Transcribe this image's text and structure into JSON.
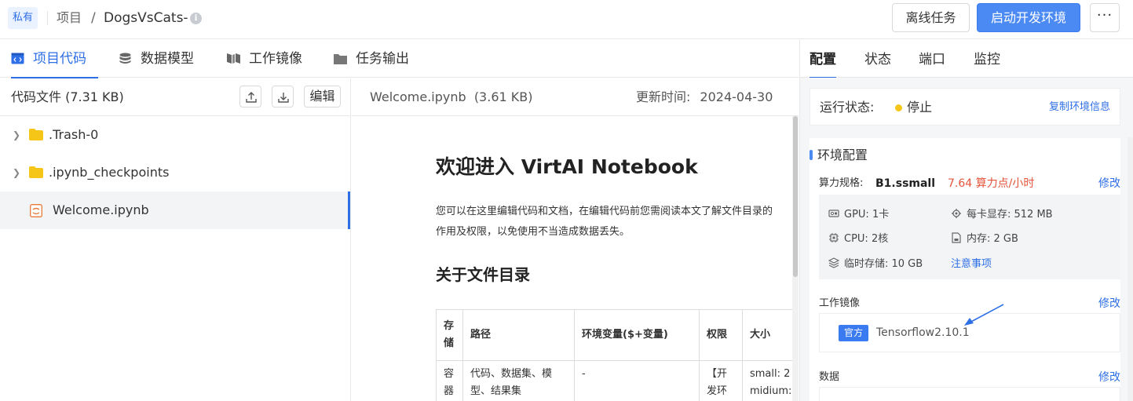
{
  "header": {
    "private_badge": "私有",
    "breadcrumb_project": "项目",
    "breadcrumb_sep": "/",
    "project_name": "DogsVsCats-",
    "offline_task_label": "离线任务",
    "start_env_label": "启动开发环境",
    "more_label": "···"
  },
  "tabs": {
    "code": "项目代码",
    "data_model": "数据模型",
    "work_image": "工作镜像",
    "task_output": "任务输出"
  },
  "file_panel": {
    "title": "代码文件 (7.31 KB)",
    "edit_label": "编辑",
    "items": [
      {
        "name": ".Trash-0",
        "type": "folder"
      },
      {
        "name": ".ipynb_checkpoints",
        "type": "folder"
      },
      {
        "name": "Welcome.ipynb",
        "type": "notebook"
      }
    ]
  },
  "document": {
    "file_name": "Welcome.ipynb  (3.61 KB)",
    "updated_label": "更新时间:",
    "updated_value": "2024-04-30",
    "h1": "欢迎进入 VirtAI Notebook",
    "intro": "您可以在这里编辑代码和文档，在编辑代码前您需阅读本文了解文件目录的作用及权限，以免使用不当造成数据丢失。",
    "h2": "关于文件目录",
    "table": {
      "headers": [
        "存储",
        "路径",
        "环境变量($+变量)",
        "权限",
        "大小"
      ],
      "row1": [
        "容器",
        "代码、数据集、模型、结果集",
        "-",
        "【开发环",
        "small: 2 midium: "
      ]
    }
  },
  "right_panel": {
    "tabs": [
      "配置",
      "状态",
      "端口",
      "监控"
    ],
    "status_label": "运行状态:",
    "status_value": "停止",
    "copy_env_label": "复制环境信息",
    "env_title": "环境配置",
    "spec_label": "算力规格:",
    "spec_value": "B1.ssmall",
    "spec_price": "7.64 算力点/小时",
    "edit_label": "修改",
    "resources": {
      "gpu": "GPU: 1卡",
      "vram": "每卡显存: 512 MB",
      "cpu": "CPU: 2核",
      "mem": "内存: 2 GB",
      "tmp": "临时存储: 10 GB",
      "notice": "注意事项"
    },
    "image_label": "工作镜像",
    "official_tag": "官方",
    "image_name": "Tensorflow2.10.1",
    "data_label": "数据"
  },
  "colors": {
    "accent": "#2e6fe6",
    "primary_button": "#4b89f3",
    "price": "#e4543a",
    "status_stopped": "#f5c518"
  }
}
